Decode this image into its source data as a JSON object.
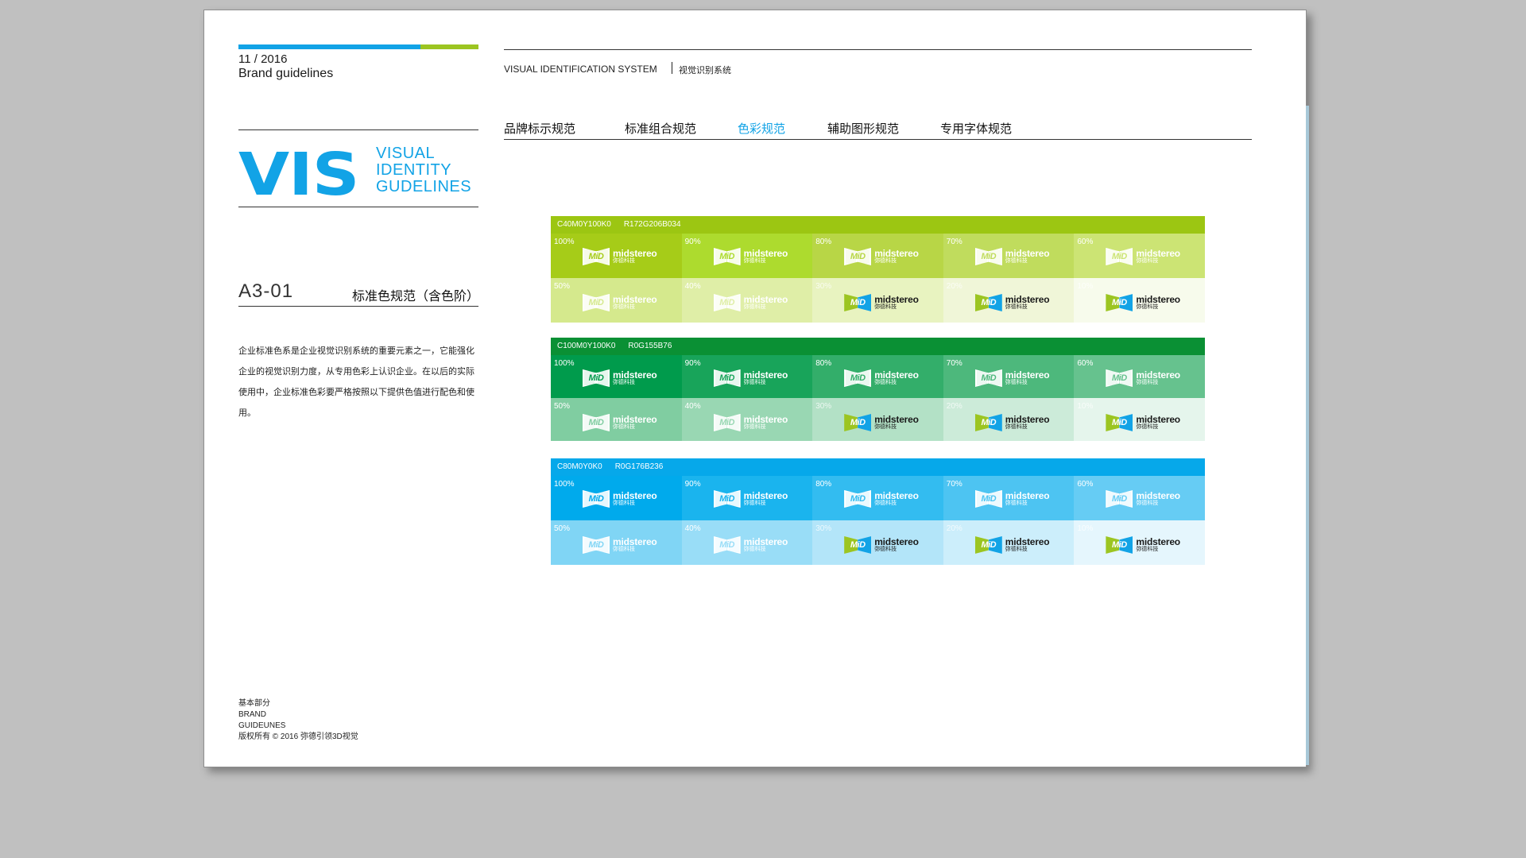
{
  "header": {
    "date": "11 / 2016",
    "brand_guidelines": "Brand guidelines",
    "system_title": "VISUAL IDENTIFICATION SYSTEM",
    "system_title_cn": "视觉识别系统"
  },
  "nav": {
    "items": [
      "品牌标示规范",
      "标准组合规范",
      "色彩规范",
      "辅助图形规范",
      "专用字体规范"
    ],
    "active": "色彩规范"
  },
  "vis": {
    "logo": "VIS",
    "line1": "VISUAL",
    "line2": "IDENTITY",
    "line3": "GUDELINES"
  },
  "section": {
    "code": "A3-01",
    "title": "标准色规范（含色阶）",
    "description": "企业标准色系是企业视觉识别系统的重要元素之一，它能强化企业的视觉识别力度，从专用色彩上认识企业。在以后的实际使用中，企业标准色彩要严格按照以下提供色值进行配色和使用。"
  },
  "footer": {
    "line1": "基本部分",
    "line2": "BRAND",
    "line3": "GUIDEUNES",
    "line4": "版权所有 © 2016   弥德引领3D视觉"
  },
  "logo_text": {
    "mark": "MiD",
    "en": "midstereo",
    "cn": "弥德科技"
  },
  "palettes": [
    {
      "cmyk": "C40M0Y100K0",
      "rgb": "R172G206B034",
      "head_color": "#9cc612",
      "tints_row1": [
        "100%",
        "90%",
        "80%",
        "70%",
        "60%"
      ],
      "tints_row2": [
        "50%",
        "40%",
        "30%",
        "20%",
        "10%"
      ],
      "colors_row1": [
        "#a6cc18",
        "#addb2e",
        "#b8d646",
        "#c0dc5d",
        "#cce474"
      ],
      "colors_row2": [
        "#d5e98d",
        "#dfeea7",
        "#e8f3c0",
        "#f0f6d8",
        "#f7fbec"
      ]
    },
    {
      "cmyk": "C100M0Y100K0",
      "rgb": "R0G155B76",
      "head_color": "#0a9034",
      "tints_row1": [
        "100%",
        "90%",
        "80%",
        "70%",
        "60%"
      ],
      "tints_row2": [
        "50%",
        "40%",
        "30%",
        "20%",
        "10%"
      ],
      "colors_row1": [
        "#009b4c",
        "#18a45a",
        "#33ae6a",
        "#4db87c",
        "#66c28e"
      ],
      "colors_row2": [
        "#80cda1",
        "#99d7b3",
        "#b3e1c6",
        "#ccebd9",
        "#e5f5ec"
      ]
    },
    {
      "cmyk": "C80M0Y0K0",
      "rgb": "R0G176B236",
      "head_color": "#06a8ea",
      "tints_row1": [
        "100%",
        "90%",
        "80%",
        "70%",
        "60%"
      ],
      "tints_row2": [
        "50%",
        "40%",
        "30%",
        "20%",
        "10%"
      ],
      "colors_row1": [
        "#00aaec",
        "#1ab4ee",
        "#33bcf0",
        "#4dc4f2",
        "#66ccf4"
      ],
      "colors_row2": [
        "#80d5f5",
        "#99ddf7",
        "#b3e5f9",
        "#cceefb",
        "#e5f6fd"
      ]
    }
  ]
}
